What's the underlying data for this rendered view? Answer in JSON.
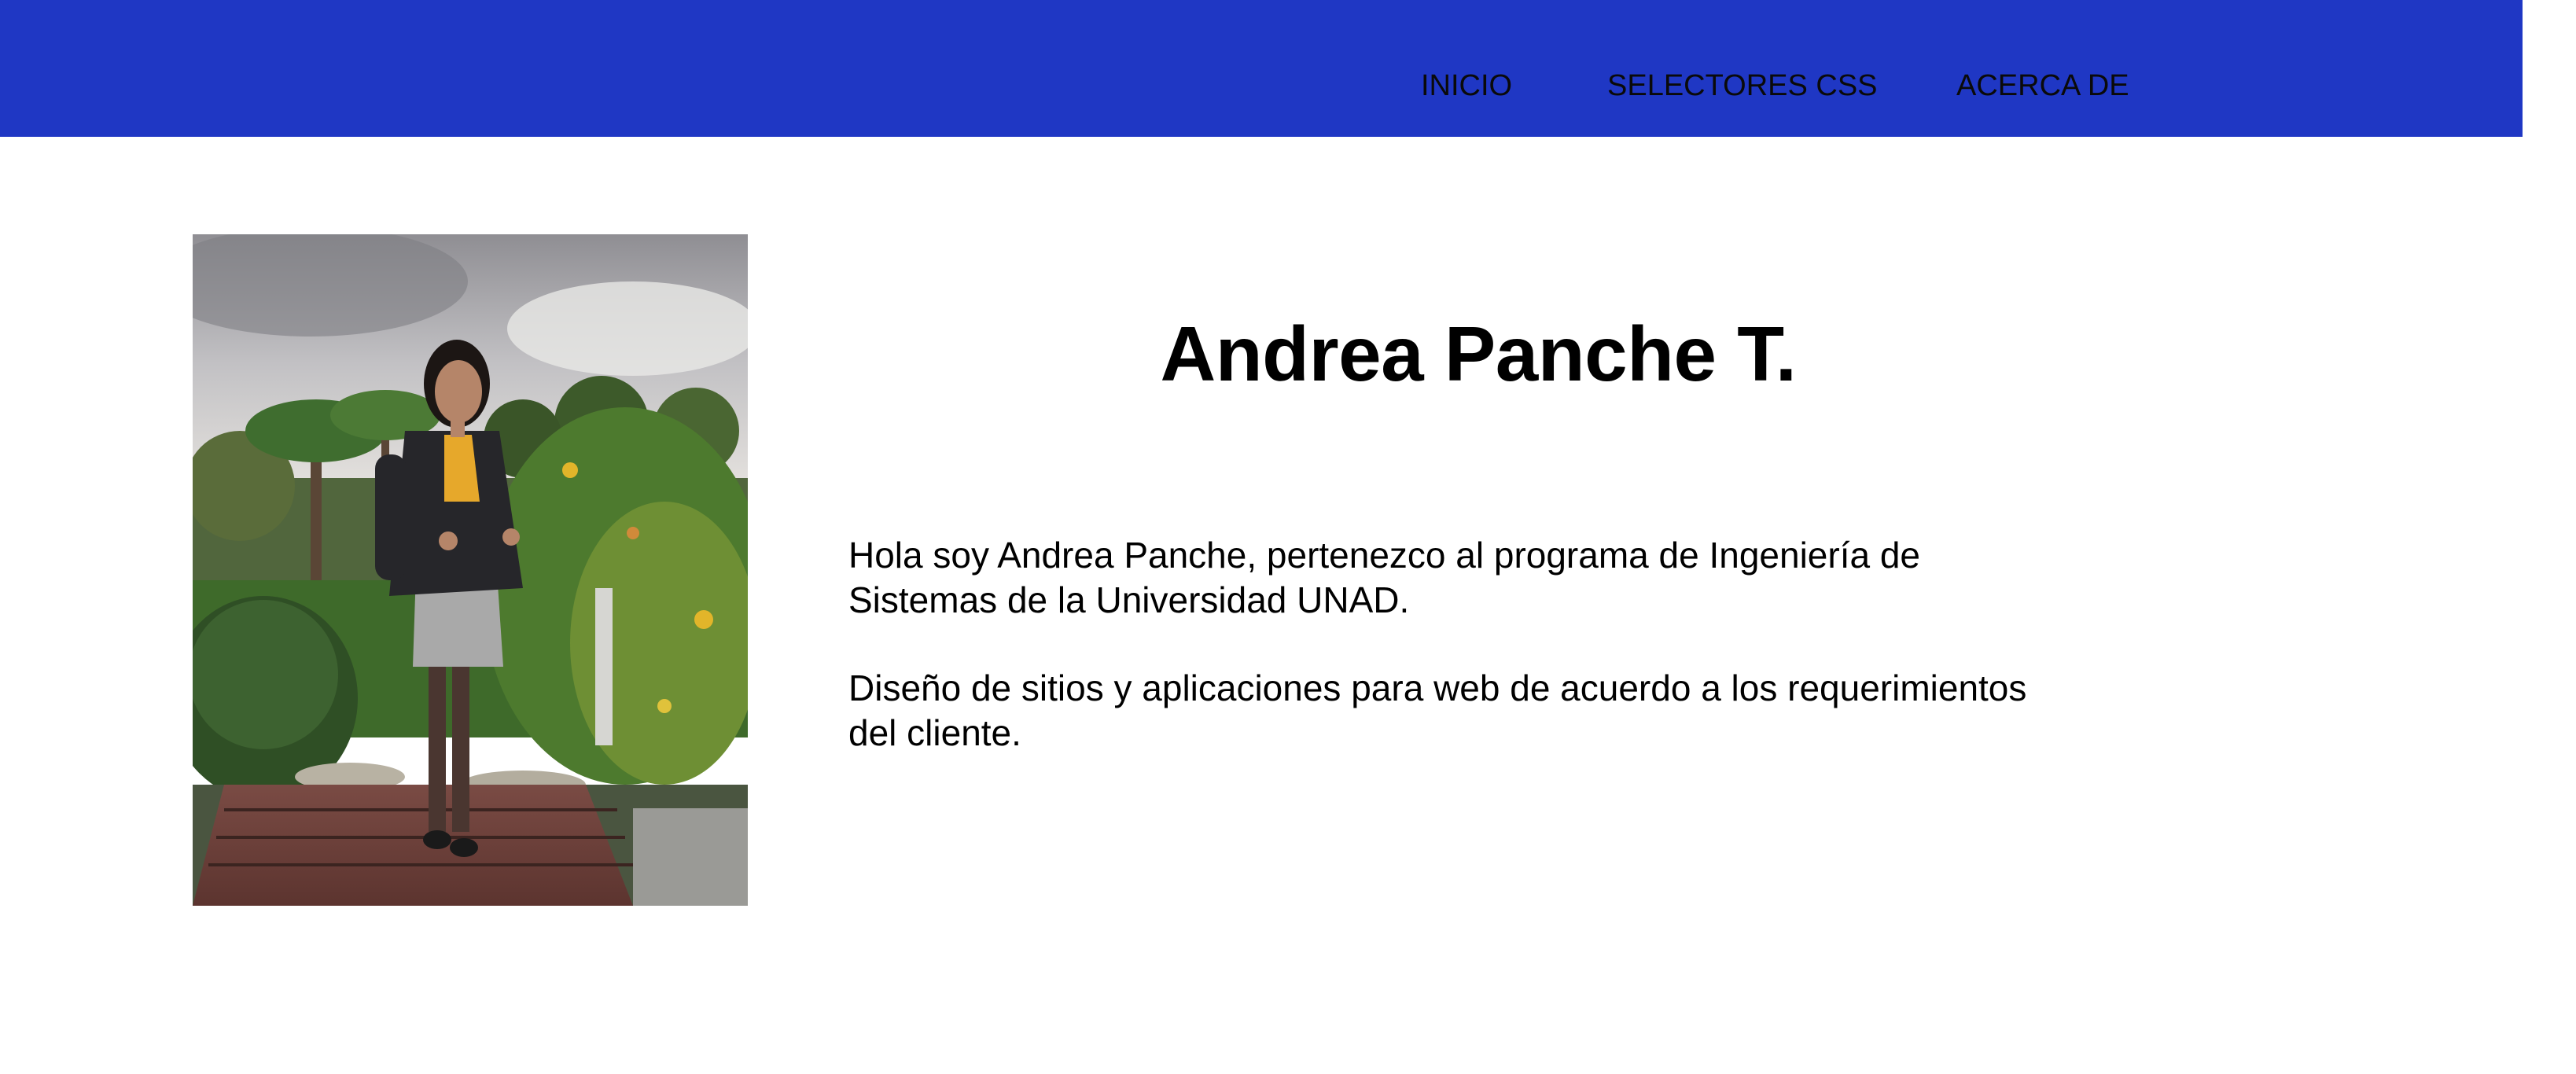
{
  "nav": {
    "items": [
      {
        "label": "INICIO"
      },
      {
        "label": "SELECTORES CSS"
      },
      {
        "label": "ACERCA DE"
      }
    ],
    "background_color": "#1f37c4"
  },
  "profile": {
    "name": "Andrea Panche T.",
    "paragraphs": [
      "Hola soy Andrea Panche, pertenezco al programa de Ingeniería de Sistemas de la Universidad UNAD.",
      "Diseño de sitios y aplicaciones para web de acuerdo a los requerimientos del cliente."
    ]
  }
}
